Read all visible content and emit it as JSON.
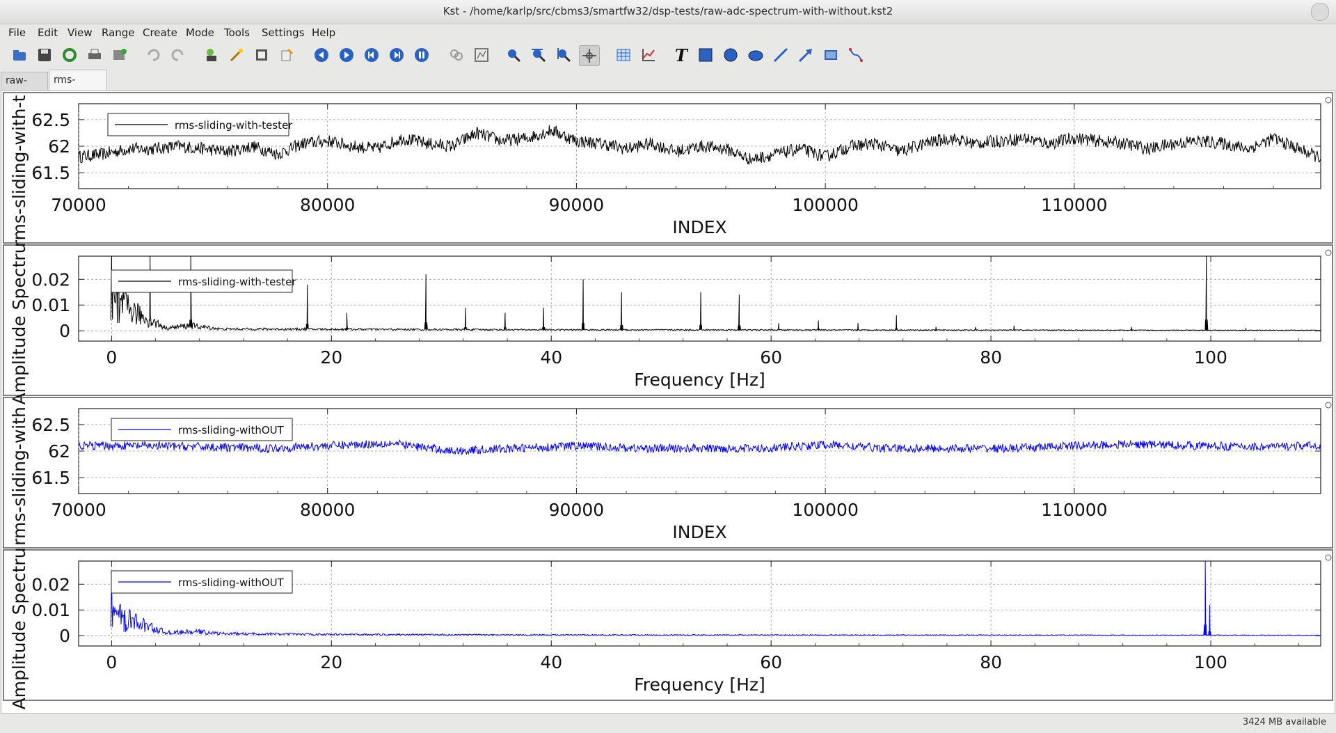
{
  "window": {
    "title": "Kst - /home/karlp/src/cbms3/smartfw32/dsp-tests/raw-adc-spectrum-with-without.kst2"
  },
  "menu": [
    "File",
    "Edit",
    "View",
    "Range",
    "Create",
    "Mode",
    "Tools",
    "Settings",
    "Help"
  ],
  "tabs": [
    {
      "label": "raw-adc"
    },
    {
      "label": "rms-sliding"
    }
  ],
  "toolbar": [
    {
      "name": "open-icon"
    },
    {
      "name": "save-icon"
    },
    {
      "name": "reload-icon"
    },
    {
      "name": "print-icon"
    },
    {
      "name": "export-icon"
    },
    {
      "name": "undo-icon"
    },
    {
      "name": "redo-icon"
    },
    {
      "name": "data-manager-icon"
    },
    {
      "name": "data-wizard-icon"
    },
    {
      "name": "change-data-file-icon"
    },
    {
      "name": "change-data-sample-icon"
    },
    {
      "name": "back-icon"
    },
    {
      "name": "forward-icon"
    },
    {
      "name": "read-from-end-icon"
    },
    {
      "name": "read-to-end-icon"
    },
    {
      "name": "pause-icon"
    },
    {
      "name": "tied-zoom-icon"
    },
    {
      "name": "auto-layout-icon"
    },
    {
      "name": "zoom-xy-icon"
    },
    {
      "name": "zoom-x-icon"
    },
    {
      "name": "zoom-y-icon"
    },
    {
      "name": "layout-mode-icon"
    },
    {
      "name": "create-table-icon"
    },
    {
      "name": "create-plot-icon"
    },
    {
      "name": "create-label-icon"
    },
    {
      "name": "create-box-icon"
    },
    {
      "name": "create-circle-icon"
    },
    {
      "name": "create-ellipse-icon"
    },
    {
      "name": "create-line-icon"
    },
    {
      "name": "create-arrow-icon"
    },
    {
      "name": "create-picture-icon"
    },
    {
      "name": "create-svg-icon"
    }
  ],
  "chart_data": [
    {
      "type": "line",
      "ylabel": "rms-sliding-with-t",
      "xlabel": "INDEX",
      "xlim": [
        70000,
        119900
      ],
      "ylim": [
        61.2,
        62.8
      ],
      "xticks": [
        70000,
        80000,
        90000,
        100000,
        110000
      ],
      "xtick_labels": [
        "70000",
        "80000",
        "90000",
        "100000",
        "110000"
      ],
      "yticks": [
        61.5,
        62,
        62.5
      ],
      "ytick_labels": [
        "61.5",
        "62",
        "62.5"
      ],
      "grid": true,
      "legend": "top-left",
      "series": [
        {
          "name": "rms-sliding-with-tester",
          "color": "#000000",
          "x": [
            70000,
            71000,
            72000,
            73000,
            74000,
            75000,
            76000,
            77000,
            78000,
            79000,
            80000,
            81000,
            82000,
            83000,
            84000,
            85000,
            86000,
            87000,
            88000,
            89000,
            90000,
            91000,
            92000,
            93000,
            94000,
            95000,
            96000,
            97000,
            98000,
            99000,
            100000,
            101000,
            102000,
            103000,
            104000,
            105000,
            106000,
            107000,
            108000,
            109000,
            110000,
            111000,
            112000,
            113000,
            114000,
            115000,
            116000,
            117000,
            118000,
            119000,
            119800
          ],
          "y": [
            61.8,
            61.85,
            61.95,
            61.95,
            62.0,
            61.95,
            61.9,
            62.0,
            61.85,
            62.05,
            62.1,
            62.0,
            61.95,
            62.15,
            62.05,
            62.0,
            62.25,
            62.1,
            62.15,
            62.3,
            62.1,
            62.05,
            61.95,
            62.05,
            61.9,
            62.0,
            61.95,
            61.75,
            61.85,
            61.95,
            61.8,
            62.0,
            62.05,
            61.9,
            62.05,
            62.15,
            62.05,
            62.1,
            62.15,
            62.05,
            62.15,
            62.1,
            62.05,
            61.95,
            62.05,
            62.1,
            62.05,
            61.95,
            62.15,
            61.95,
            61.8
          ],
          "noise": 0.12
        }
      ]
    },
    {
      "type": "line",
      "ylabel": "Amplitude Spectru",
      "xlabel": "Frequency [Hz]",
      "xlim": [
        -3,
        110
      ],
      "ylim": [
        -0.004,
        0.029
      ],
      "xticks": [
        0,
        20,
        40,
        60,
        80,
        100
      ],
      "xtick_labels": [
        "0",
        "20",
        "40",
        "60",
        "80",
        "100"
      ],
      "yticks": [
        0,
        0.01,
        0.02
      ],
      "ytick_labels": [
        "0",
        "0.01",
        "0.02"
      ],
      "grid": true,
      "legend": "top-left",
      "series": [
        {
          "name": "rms-sliding-with-tester",
          "color": "#000000",
          "baseline": [
            [
              0,
              0.012
            ],
            [
              3,
              0.005
            ],
            [
              5,
              0.001
            ],
            [
              7,
              0.002
            ],
            [
              10,
              0.0007
            ],
            [
              20,
              0.0006
            ],
            [
              40,
              0.0004
            ],
            [
              100,
              0.0002
            ],
            [
              110,
              0.0002
            ]
          ],
          "peaks": [
            [
              0,
              0.029
            ],
            [
              0.6,
              0.02
            ],
            [
              3.5,
              0.029
            ],
            [
              7.2,
              0.029
            ],
            [
              17.8,
              0.018
            ],
            [
              21.4,
              0.007
            ],
            [
              28.6,
              0.022
            ],
            [
              32.2,
              0.009
            ],
            [
              35.8,
              0.007
            ],
            [
              39.3,
              0.009
            ],
            [
              42.9,
              0.02
            ],
            [
              46.4,
              0.015
            ],
            [
              53.6,
              0.015
            ],
            [
              57.1,
              0.014
            ],
            [
              60.7,
              0.003
            ],
            [
              64.3,
              0.004
            ],
            [
              67.9,
              0.003
            ],
            [
              71.4,
              0.006
            ],
            [
              75.0,
              0.0015
            ],
            [
              78.6,
              0.0015
            ],
            [
              82.1,
              0.002
            ],
            [
              92.8,
              0.0015
            ],
            [
              99.6,
              0.029
            ],
            [
              103.2,
              0.001
            ]
          ]
        }
      ]
    },
    {
      "type": "line",
      "ylabel": "rms-sliding-with",
      "xlabel": "INDEX",
      "xlim": [
        70000,
        119900
      ],
      "ylim": [
        61.2,
        62.8
      ],
      "xticks": [
        70000,
        80000,
        90000,
        100000,
        110000
      ],
      "xtick_labels": [
        "70000",
        "80000",
        "90000",
        "100000",
        "110000"
      ],
      "yticks": [
        61.5,
        62,
        62.5
      ],
      "ytick_labels": [
        "61.5",
        "62",
        "62.5"
      ],
      "grid": true,
      "legend": "top-left",
      "series": [
        {
          "name": "rms-sliding-withOUT",
          "color": "#0000ff",
          "x": [
            70000,
            72500,
            75000,
            77500,
            80000,
            82500,
            85000,
            87500,
            90000,
            92500,
            95000,
            97500,
            100000,
            102500,
            105000,
            107500,
            110000,
            112500,
            115000,
            117500,
            119800
          ],
          "y": [
            62.1,
            62.1,
            62.08,
            62.05,
            62.1,
            62.15,
            62.0,
            62.05,
            62.1,
            62.05,
            62.05,
            62.05,
            62.12,
            62.05,
            62.05,
            62.05,
            62.1,
            62.13,
            62.1,
            62.08,
            62.1
          ],
          "noise": 0.08
        }
      ]
    },
    {
      "type": "line",
      "ylabel": "Amplitude Spectru",
      "xlabel": "Frequency [Hz]",
      "xlim": [
        -3,
        110
      ],
      "ylim": [
        -0.004,
        0.029
      ],
      "xticks": [
        0,
        20,
        40,
        60,
        80,
        100
      ],
      "xtick_labels": [
        "0",
        "20",
        "40",
        "60",
        "80",
        "100"
      ],
      "yticks": [
        0,
        0.01,
        0.02
      ],
      "ytick_labels": [
        "0",
        "0.01",
        "0.02"
      ],
      "grid": true,
      "legend": "top-left",
      "series": [
        {
          "name": "rms-sliding-withOUT",
          "color": "#0000ff",
          "baseline": [
            [
              0,
              0.009
            ],
            [
              1,
              0.007
            ],
            [
              3,
              0.004
            ],
            [
              5,
              0.0012
            ],
            [
              8,
              0.0015
            ],
            [
              10,
              0.0008
            ],
            [
              20,
              0.0005
            ],
            [
              40,
              0.0003
            ],
            [
              100,
              0.0002
            ],
            [
              110,
              0.0002
            ]
          ],
          "peaks": [
            [
              0,
              0.023
            ],
            [
              1.2,
              0.01
            ],
            [
              99.5,
              0.029
            ],
            [
              99.9,
              0.012
            ]
          ]
        }
      ]
    }
  ],
  "status": {
    "memory": "3424 MB available"
  }
}
